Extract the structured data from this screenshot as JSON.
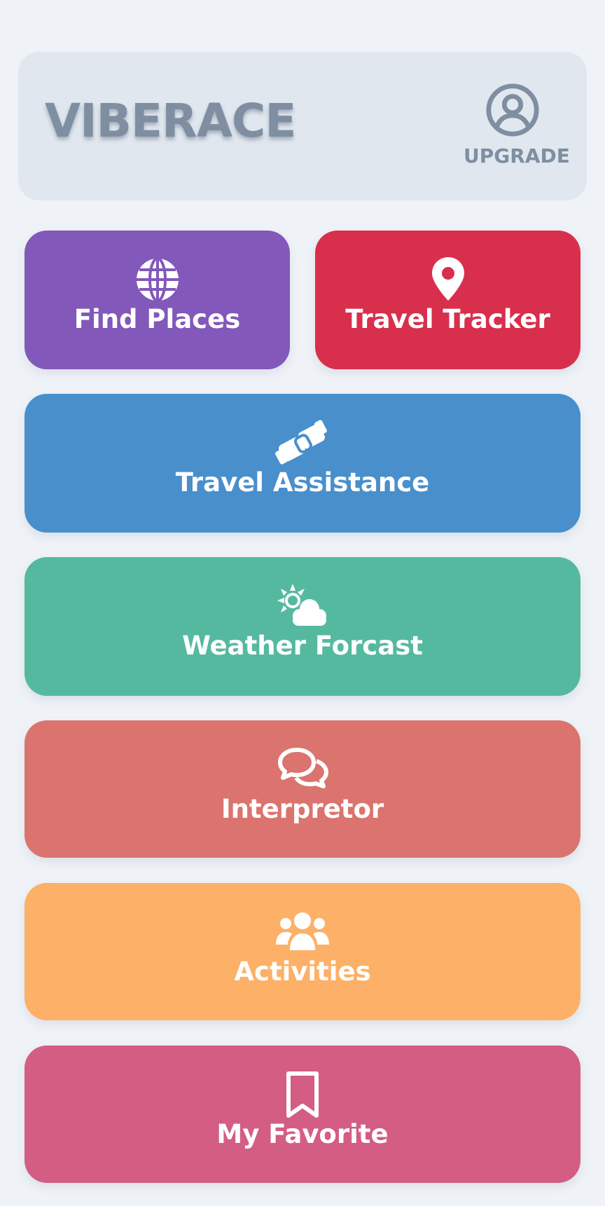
{
  "app": {
    "brand": "VIBERACE"
  },
  "header": {
    "upgrade_label": "UPGRADE",
    "upgrade_icon": "user-circle-icon"
  },
  "colors": {
    "background": "#eff3f8",
    "header": "#e0e7ef",
    "muted_text": "#7f8ea1",
    "find_places": "#8258ba",
    "travel_tracker": "#d82f4d",
    "travel_assistance": "#488fcc",
    "weather_forcast": "#55b9a0",
    "interpretor": "#db746e",
    "activities": "#fdb067",
    "my_favorite": "#d45d84"
  },
  "tiles": {
    "find_places": {
      "label": "Find Places",
      "icon": "globe-icon"
    },
    "travel_tracker": {
      "label": "Travel Tracker",
      "icon": "map-pin-icon"
    },
    "travel_assistance": {
      "label": "Travel Assistance",
      "icon": "handshake-icon"
    },
    "weather_forcast": {
      "label": "Weather Forcast",
      "icon": "sun-cloud-icon"
    },
    "interpretor": {
      "label": "Interpretor",
      "icon": "chat-bubbles-icon"
    },
    "activities": {
      "label": "Activities",
      "icon": "group-people-icon"
    },
    "my_favorite": {
      "label": "My Favorite",
      "icon": "bookmark-icon"
    }
  }
}
